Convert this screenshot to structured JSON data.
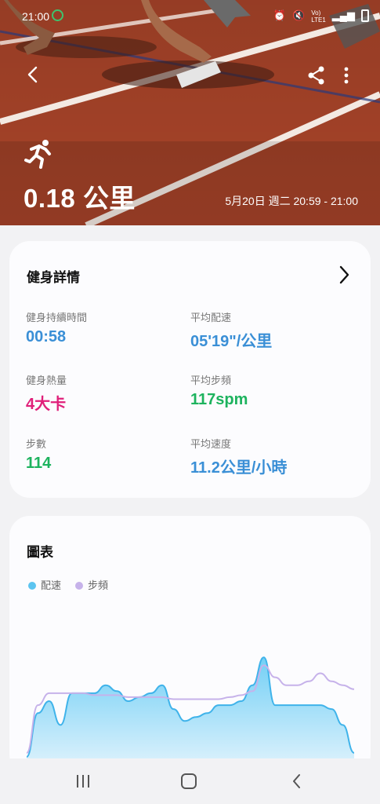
{
  "status_bar": {
    "time": "21:00",
    "icons": [
      "alarm-icon",
      "mute-icon",
      "volte-icon",
      "signal-icon",
      "battery-icon"
    ]
  },
  "header": {
    "distance": "0.18 公里",
    "datetime": "5月20日 週二 20:59 - 21:00"
  },
  "fitness_details": {
    "title": "健身詳情",
    "stats": [
      {
        "label": "健身持續時間",
        "value": "00:58",
        "color": "#3a8fd6"
      },
      {
        "label": "平均配速",
        "value": "05'19\"/公里",
        "color": "#3a8fd6"
      },
      {
        "label": "健身熱量",
        "value": "4大卡",
        "color": "#e0207a"
      },
      {
        "label": "平均步頻",
        "value": "117spm",
        "color": "#1db35e"
      },
      {
        "label": "步數",
        "value": "114",
        "color": "#1db35e"
      },
      {
        "label": "平均速度",
        "value": "11.2公里/小時",
        "color": "#3a8fd6"
      }
    ]
  },
  "chart_section": {
    "title": "圖表",
    "legend": [
      {
        "name": "配速",
        "color": "#5cc4f0"
      },
      {
        "name": "步頻",
        "color": "#c6b2ea"
      }
    ]
  },
  "chart_data": {
    "type": "area",
    "x": [
      0,
      2,
      4,
      6,
      8,
      10,
      12,
      14,
      16,
      18,
      20,
      22,
      24,
      26,
      28,
      30,
      32,
      34,
      36,
      38,
      40,
      42,
      44,
      46,
      48,
      50,
      52,
      54,
      56,
      58
    ],
    "series": [
      {
        "name": "配速",
        "values": [
          2,
          24,
          30,
          18,
          34,
          34,
          34,
          38,
          35,
          30,
          32,
          34,
          38,
          26,
          20,
          22,
          24,
          28,
          28,
          30,
          38,
          52,
          28,
          28,
          28,
          28,
          28,
          26,
          18,
          4
        ]
      },
      {
        "name": "步頻",
        "values": [
          4,
          28,
          34,
          34,
          34,
          34,
          33,
          33,
          33,
          32,
          32,
          32,
          32,
          31,
          31,
          31,
          31,
          31,
          32,
          33,
          35,
          48,
          42,
          38,
          38,
          40,
          44,
          40,
          38,
          36
        ]
      }
    ]
  }
}
